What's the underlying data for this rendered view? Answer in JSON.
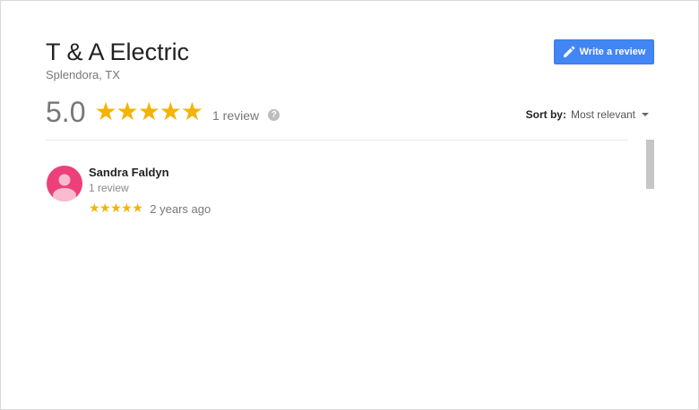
{
  "business": {
    "name": "T & A Electric",
    "location": "Splendora, TX"
  },
  "actions": {
    "write_review_label": "Write a review",
    "write_review_icon": "pencil-icon"
  },
  "summary": {
    "rating": "5.0",
    "stars": "★★★★★",
    "star_count": 5,
    "review_count": "1 review",
    "help_icon": "?"
  },
  "sort": {
    "label": "Sort by:",
    "value": "Most relevant"
  },
  "reviews": [
    {
      "author": "Sandra Faldyn",
      "author_review_count": "1 review",
      "stars": "★★★★★",
      "star_count": 5,
      "date": "2 years ago"
    }
  ],
  "colors": {
    "accent": "#4285f4",
    "star": "#f4b400",
    "avatar": "#ec407a"
  }
}
